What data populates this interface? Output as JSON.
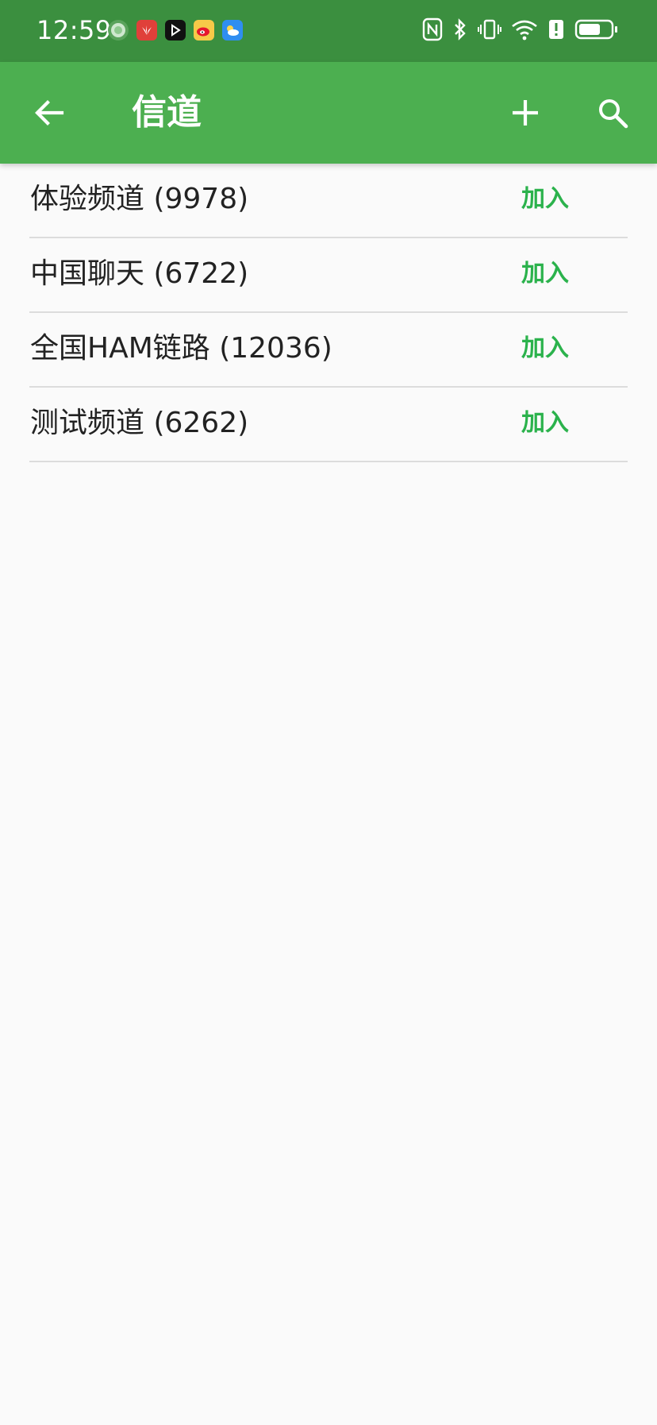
{
  "status_bar": {
    "time": "12:59",
    "notification_icons": [
      "assistant-icon",
      "huawei-icon",
      "video-app-icon",
      "weibo-icon",
      "weather-icon"
    ],
    "system_icons": [
      "nfc-icon",
      "bluetooth-icon",
      "vibrate-icon",
      "wifi-icon",
      "alert-icon",
      "battery-icon"
    ]
  },
  "app_bar": {
    "title": "信道",
    "back_icon": "arrow-left-icon",
    "add_icon": "plus-icon",
    "search_icon": "search-icon",
    "background_color": "#4caf50"
  },
  "channels": [
    {
      "name": "体验频道 (9978)",
      "action": "加入"
    },
    {
      "name": "中国聊天 (6722)",
      "action": "加入"
    },
    {
      "name": "全国HAM链路 (12036)",
      "action": "加入"
    },
    {
      "name": "测试频道 (6262)",
      "action": "加入"
    }
  ],
  "colors": {
    "status_bar": "#3b8f3f",
    "accent": "#2bb24c",
    "text": "#222222",
    "divider": "#dcdcdc"
  }
}
